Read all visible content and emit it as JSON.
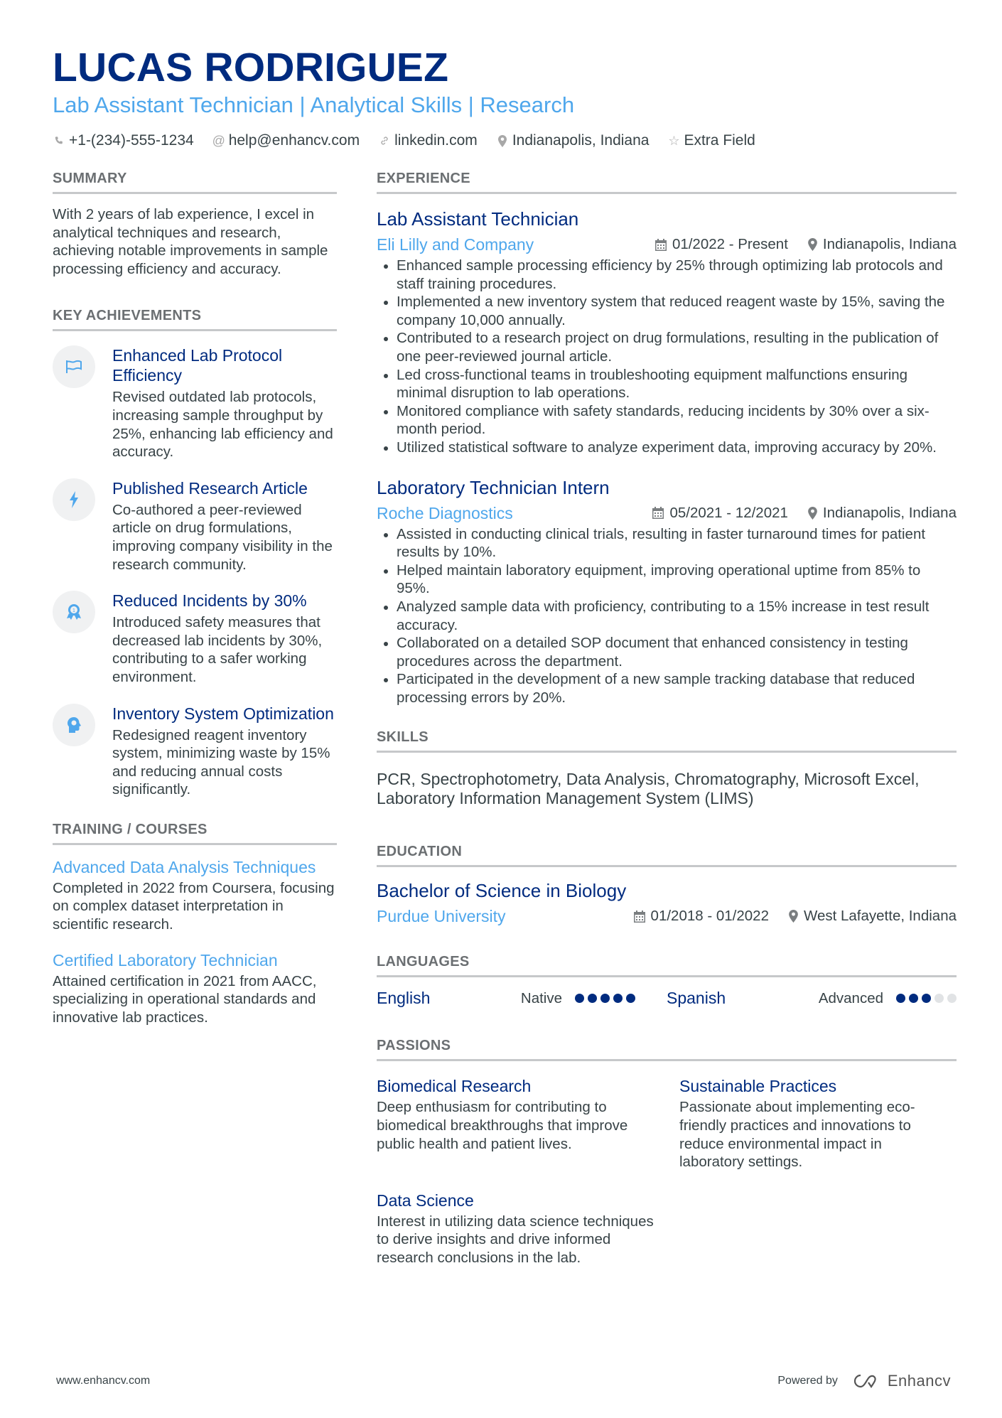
{
  "header": {
    "name": "LUCAS RODRIGUEZ",
    "headline": "Lab Assistant Technician | Analytical Skills | Research",
    "contacts": [
      {
        "icon": "phone-icon",
        "text": "+1-(234)-555-1234"
      },
      {
        "icon": "at-icon",
        "text": "help@enhancv.com"
      },
      {
        "icon": "link-icon",
        "text": "linkedin.com"
      },
      {
        "icon": "location-pin-icon",
        "text": "Indianapolis, Indiana"
      },
      {
        "icon": "star-icon",
        "text": "Extra Field"
      }
    ]
  },
  "summary": {
    "title": "SUMMARY",
    "text": "With 2 years of lab experience, I excel in analytical techniques and research, achieving notable improvements in sample processing efficiency and accuracy."
  },
  "achievements": {
    "title": "KEY ACHIEVEMENTS",
    "items": [
      {
        "icon": "flag-icon",
        "title": "Enhanced Lab Protocol Efficiency",
        "text": "Revised outdated lab protocols, increasing sample throughput by 25%, enhancing lab efficiency and accuracy."
      },
      {
        "icon": "lightning-bolt-icon",
        "title": "Published Research Article",
        "text": "Co-authored a peer-reviewed article on drug formulations, improving company visibility in the research community."
      },
      {
        "icon": "award-ribbon-icon",
        "title": "Reduced Incidents by 30%",
        "text": "Introduced safety measures that decreased lab incidents by 30%, contributing to a safer working environment."
      },
      {
        "icon": "head-brain-icon",
        "title": "Inventory System Optimization",
        "text": "Redesigned reagent inventory system, minimizing waste by 15% and reducing annual costs significantly."
      }
    ]
  },
  "training": {
    "title": "TRAINING / COURSES",
    "items": [
      {
        "title": "Advanced Data Analysis Techniques",
        "text": "Completed in 2022 from Coursera, focusing on complex dataset interpretation in scientific research."
      },
      {
        "title": "Certified Laboratory Technician",
        "text": "Attained certification in 2021 from AACC, specializing in operational standards and innovative lab practices."
      }
    ]
  },
  "experience": {
    "title": "EXPERIENCE",
    "jobs": [
      {
        "title": "Lab Assistant Technician",
        "company": "Eli Lilly and Company",
        "dates": "01/2022 - Present",
        "location": "Indianapolis, Indiana",
        "bullets": [
          "Enhanced sample processing efficiency by 25% through optimizing lab protocols and staff training procedures.",
          "Implemented a new inventory system that reduced reagent waste by 15%, saving the company 10,000 annually.",
          "Contributed to a research project on drug formulations, resulting in the publication of one peer-reviewed journal article.",
          "Led cross-functional teams in troubleshooting equipment malfunctions ensuring minimal disruption to lab operations.",
          "Monitored compliance with safety standards, reducing incidents by 30% over a six-month period.",
          "Utilized statistical software to analyze experiment data, improving accuracy by 20%."
        ]
      },
      {
        "title": "Laboratory Technician Intern",
        "company": "Roche Diagnostics",
        "dates": "05/2021 - 12/2021",
        "location": "Indianapolis, Indiana",
        "bullets": [
          "Assisted in conducting clinical trials, resulting in faster turnaround times for patient results by 10%.",
          "Helped maintain laboratory equipment, improving operational uptime from 85% to 95%.",
          "Analyzed sample data with proficiency, contributing to a 15% increase in test result accuracy.",
          "Collaborated on a detailed SOP document that enhanced consistency in testing procedures across the department.",
          "Participated in the development of a new sample tracking database that reduced processing errors by 20%."
        ]
      }
    ]
  },
  "skills": {
    "title": "SKILLS",
    "text": "PCR, Spectrophotometry, Data Analysis, Chromatography, Microsoft Excel, Laboratory Information Management System (LIMS)"
  },
  "education": {
    "title": "EDUCATION",
    "degree": "Bachelor of Science in Biology",
    "school": "Purdue University",
    "dates": "01/2018 - 01/2022",
    "location": "West Lafayette, Indiana"
  },
  "languages": {
    "title": "LANGUAGES",
    "items": [
      {
        "name": "English",
        "level": "Native",
        "rating": 5,
        "max": 5
      },
      {
        "name": "Spanish",
        "level": "Advanced",
        "rating": 3,
        "max": 5
      }
    ]
  },
  "passions": {
    "title": "PASSIONS",
    "items": [
      {
        "title": "Biomedical Research",
        "text": "Deep enthusiasm for contributing to biomedical breakthroughs that improve public health and patient lives."
      },
      {
        "title": "Sustainable Practices",
        "text": "Passionate about implementing eco-friendly practices and innovations to reduce environmental impact in laboratory settings."
      },
      {
        "title": "Data Science",
        "text": "Interest in utilizing data science techniques to derive insights and drive informed research conclusions in the lab."
      }
    ]
  },
  "footer": {
    "url": "www.enhancv.com",
    "powered_by": "Powered by",
    "brand": "Enhancv"
  },
  "colors": {
    "name": "#002b7f",
    "accent": "#4fa7ec",
    "text": "#384347",
    "rule": "#c6c8ca"
  }
}
